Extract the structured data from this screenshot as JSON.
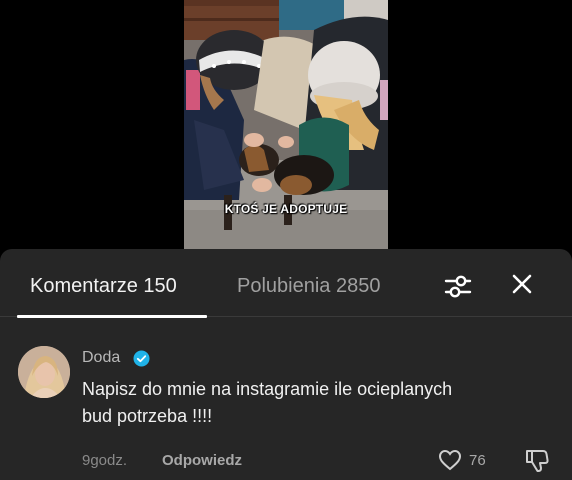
{
  "video": {
    "caption": "KTOŚ JE ADOPTUJE"
  },
  "tabs": [
    {
      "label": "Komentarze 150",
      "active": true
    },
    {
      "label": "Polubienia 2850",
      "active": false
    }
  ],
  "icons": {
    "filter": "filter-icon",
    "close": "close-icon",
    "verified": "verified-badge-icon",
    "like": "heart-icon",
    "dislike": "thumbs-down-icon"
  },
  "comment": {
    "author": "Doda",
    "text": "Napisz do mnie na instagramie ile ocieplanych bud potrzeba !!!!",
    "time": "9godz.",
    "reply_label": "Odpowiedz",
    "likes": "76"
  },
  "colors": {
    "panel": "#262626",
    "verified": "#20b3e8"
  }
}
